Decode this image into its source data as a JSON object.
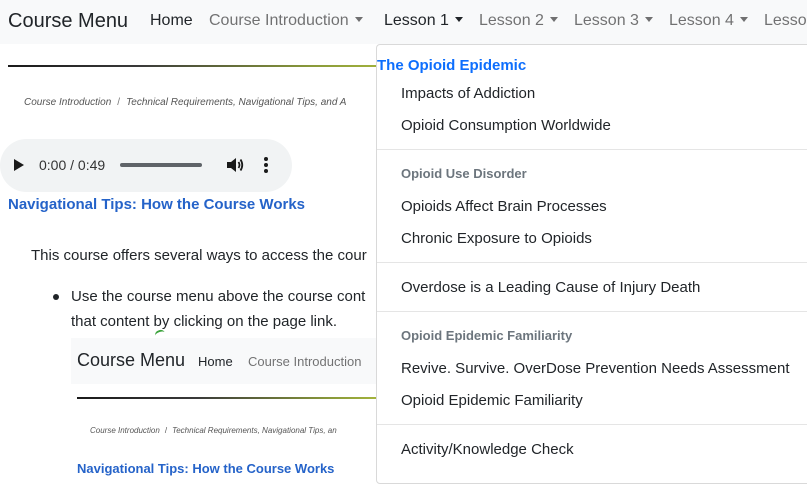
{
  "navbar": {
    "brand": "Course Menu",
    "items": [
      {
        "label": "Home"
      },
      {
        "label": "Course Introduction"
      },
      {
        "label": "Lesson 1"
      },
      {
        "label": "Lesson 2"
      },
      {
        "label": "Lesson 3"
      },
      {
        "label": "Lesson 4"
      },
      {
        "label": "Lesson"
      }
    ]
  },
  "breadcrumb": {
    "items": [
      "Course Introduction",
      "Technical Requirements, Navigational Tips, and A"
    ]
  },
  "audio": {
    "time": "0:00 / 0:49"
  },
  "content": {
    "section_title": "Navigational Tips: How the Course Works",
    "paragraph": "This course offers several ways to access the cour",
    "bullet_line1": "Use the course menu above the course cont",
    "bullet_line2": "that content by clicking on the page link."
  },
  "thumbnail": {
    "brand": "Course Menu",
    "home": "Home",
    "intro": "Course Introduction",
    "breadcrumb": [
      "Course Introduction",
      "Technical Requirements, Navigational Tips, an"
    ],
    "title": "Navigational Tips: How the Course Works"
  },
  "dropdown": {
    "header": "The Opioid Epidemic",
    "items1": [
      "Impacts of Addiction",
      "Opioid Consumption Worldwide"
    ],
    "group2": "Opioid Use Disorder",
    "items2": [
      "Opioids Affect Brain Processes",
      "Chronic Exposure to Opioids"
    ],
    "items3": [
      "Overdose is a Leading Cause of Injury Death"
    ],
    "group4": "Opioid Epidemic Familiarity",
    "items4": [
      "Revive. Survive. OverDose Prevention Needs Assessment",
      "Opioid Epidemic Familiarity"
    ],
    "items5": [
      "Activity/Knowledge Check"
    ]
  }
}
